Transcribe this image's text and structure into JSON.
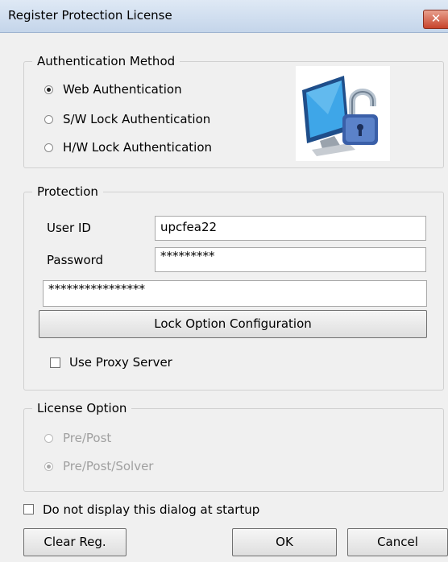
{
  "window": {
    "title": "Register Protection License",
    "close_glyph": "✕"
  },
  "auth": {
    "legend": "Authentication Method",
    "options": [
      {
        "label": "Web Authentication",
        "checked": true
      },
      {
        "label": "S/W Lock Authentication",
        "checked": false
      },
      {
        "label": "H/W Lock Authentication",
        "checked": false
      }
    ],
    "icon": "computer-padlock-icon"
  },
  "protection": {
    "legend": "Protection",
    "user_id_label": "User ID",
    "user_id_value": "upcfea22",
    "password_label": "Password",
    "password_value": "*********",
    "key_value": "****************",
    "lock_button": "Lock Option Configuration",
    "proxy_label": "Use Proxy Server",
    "proxy_checked": false
  },
  "license": {
    "legend": "License Option",
    "options": [
      {
        "label": "Pre/Post",
        "checked": false
      },
      {
        "label": "Pre/Post/Solver",
        "checked": true
      }
    ]
  },
  "startup": {
    "label": "Do not display this dialog at startup",
    "checked": false
  },
  "buttons": {
    "clear": "Clear Reg.",
    "ok": "OK",
    "cancel": "Cancel"
  },
  "colors": {
    "titlebar": "#c4d5ea",
    "close": "#c7442c",
    "disabled_text": "#a0a0a0"
  }
}
